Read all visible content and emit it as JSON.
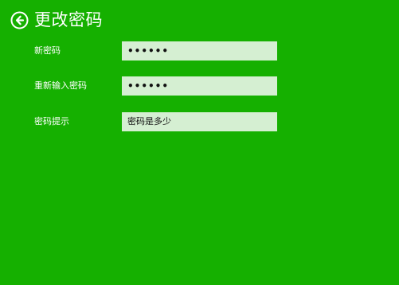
{
  "header": {
    "back_icon": "circle-arrow-left-icon",
    "title": "更改密码"
  },
  "form": {
    "new_password": {
      "label": "新密码",
      "value": "••••••"
    },
    "confirm_password": {
      "label": "重新输入密码",
      "value": "••••••"
    },
    "hint": {
      "label": "密码提示",
      "value": "密码是多少"
    }
  },
  "colors": {
    "background": "#15b000",
    "input_background": "#d5efd2",
    "text": "#ffffff"
  }
}
